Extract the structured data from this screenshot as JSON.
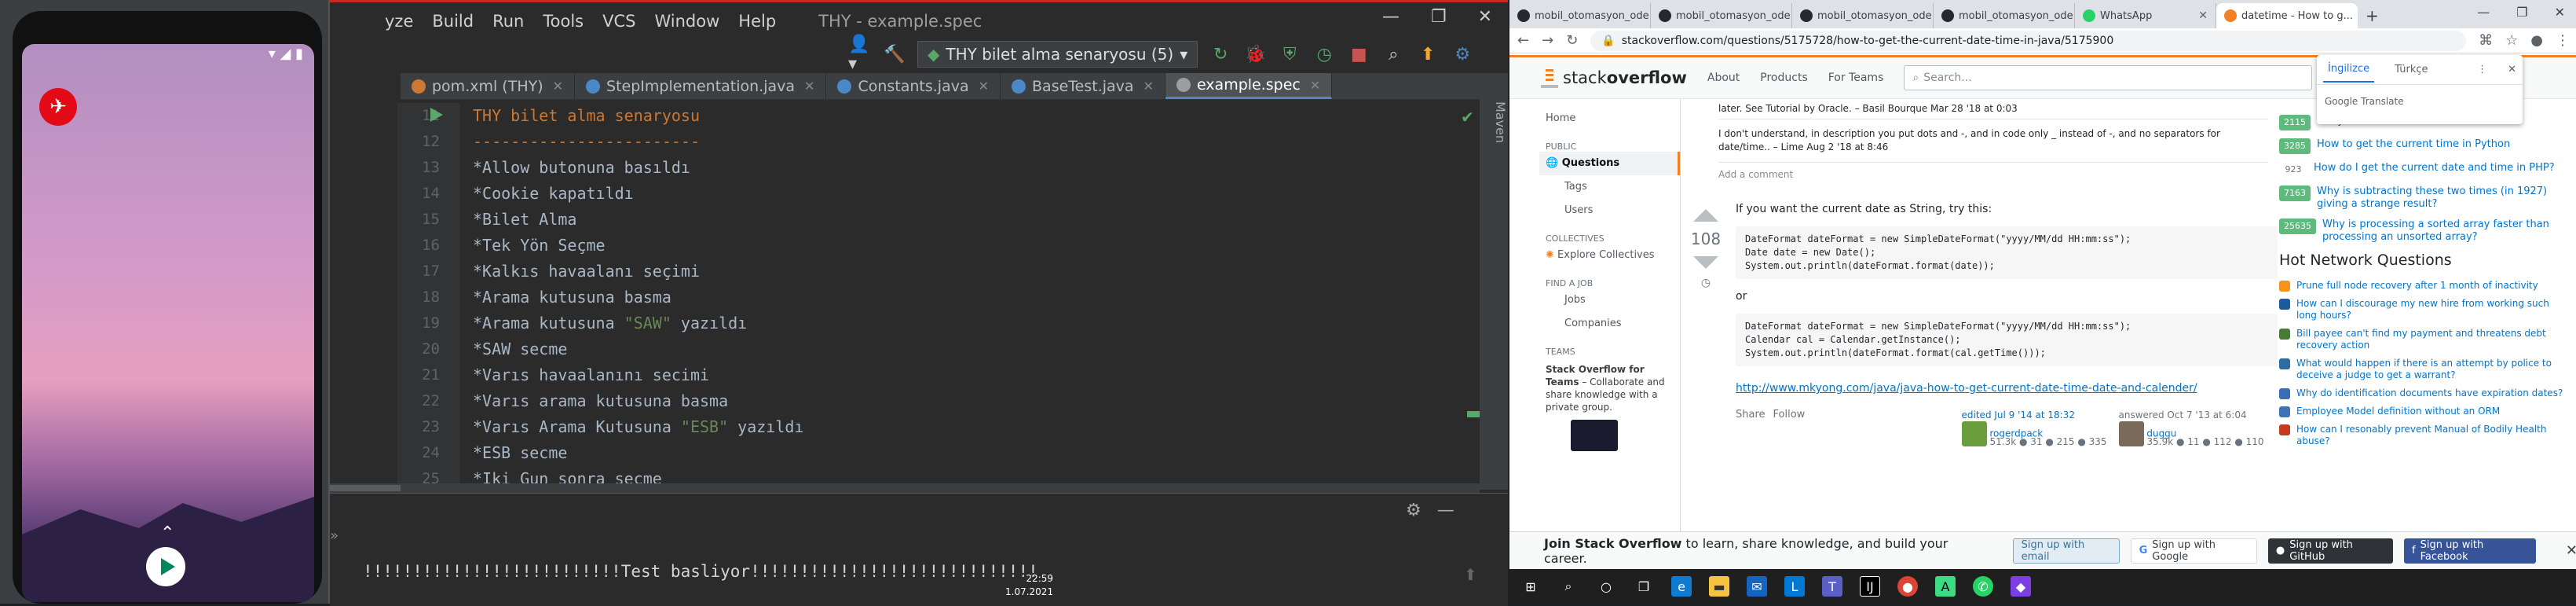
{
  "emulator": {
    "status_time": "",
    "logo_letter": "✈"
  },
  "ide": {
    "menu": [
      "yze",
      "Build",
      "Run",
      "Tools",
      "VCS",
      "Window",
      "Help"
    ],
    "title": "THY - example.spec",
    "run_config": "THY bilet alma senaryosu (5)",
    "tabs": [
      {
        "label": "pom.xml (THY)",
        "icon_color": "#cc7832",
        "active": false
      },
      {
        "label": "StepImplementation.java",
        "icon_color": "#4a88c7",
        "active": false
      },
      {
        "label": "Constants.java",
        "icon_color": "#4a88c7",
        "active": false
      },
      {
        "label": "BaseTest.java",
        "icon_color": "#4a88c7",
        "active": false
      },
      {
        "label": "example.spec",
        "icon_color": "#9e9e9e",
        "active": true
      }
    ],
    "right_strip_label": "Maven",
    "line_numbers": [
      "11",
      "12",
      "13",
      "14",
      "15",
      "16",
      "17",
      "18",
      "19",
      "20",
      "21",
      "22",
      "23",
      "24",
      "25"
    ],
    "code_lines": [
      {
        "pre": "THY bilet alma senaryosu",
        "str": "",
        "post": "",
        "kind": "heading"
      },
      {
        "pre": "------------------------",
        "str": "",
        "post": "",
        "kind": "heading"
      },
      {
        "pre": "*Allow butonuna basıldı",
        "str": "",
        "post": "",
        "kind": "text"
      },
      {
        "pre": "*Cookie kapatıldı",
        "str": "",
        "post": "",
        "kind": "text"
      },
      {
        "pre": "*Bilet Alma",
        "str": "",
        "post": "",
        "kind": "text"
      },
      {
        "pre": "*Tek Yön Seçme",
        "str": "",
        "post": "",
        "kind": "text"
      },
      {
        "pre": "*Kalkıs havaalanı seçimi",
        "str": "",
        "post": "",
        "kind": "text"
      },
      {
        "pre": "*Arama kutusuna basma",
        "str": "",
        "post": "",
        "kind": "text"
      },
      {
        "pre": "*Arama kutusuna ",
        "str": "\"SAW\"",
        "post": " yazıldı",
        "kind": "text"
      },
      {
        "pre": "*SAW secme",
        "str": "",
        "post": "",
        "kind": "text"
      },
      {
        "pre": "*Varıs havaalanını secimi",
        "str": "",
        "post": "",
        "kind": "text"
      },
      {
        "pre": "*Varıs arama kutusuna basma",
        "str": "",
        "post": "",
        "kind": "text"
      },
      {
        "pre": "*Varıs Arama Kutusuna ",
        "str": "\"ESB\"",
        "post": " yazıldı",
        "kind": "text"
      },
      {
        "pre": "*ESB secme",
        "str": "",
        "post": "",
        "kind": "text"
      },
      {
        "pre": "*Iki Gun sonra secme",
        "str": "",
        "post": "",
        "kind": "text"
      }
    ],
    "console_text": "!!!!!!!!!!!!!!!!!!!!!!!!!!Test basliyor!!!!!!!!!!!!!!!!!!!!!!!!!!!!!"
  },
  "browser": {
    "tabs": [
      {
        "label": "mobil_otomasyon_ode",
        "active": false
      },
      {
        "label": "mobil_otomasyon_ode",
        "active": false
      },
      {
        "label": "mobil_otomasyon_ode",
        "active": false
      },
      {
        "label": "mobil_otomasyon_ode",
        "active": false
      },
      {
        "label": "WhatsApp",
        "active": false
      },
      {
        "label": "datetime - How to g...",
        "active": true
      }
    ],
    "url": "stackoverflow.com/questions/5175728/how-to-get-the-current-date-time-in-java/5175900",
    "translate": {
      "lang1": "İngilizce",
      "lang2": "Türkçe",
      "footer": "Google Translate"
    }
  },
  "so": {
    "logo_a": "stack",
    "logo_b": "overflow",
    "nav": [
      "About",
      "Products",
      "For Teams"
    ],
    "search_placeholder": "Search...",
    "left": {
      "home": "Home",
      "public": "PUBLIC",
      "questions": "Questions",
      "tags": "Tags",
      "users": "Users",
      "collectives": "COLLECTIVES",
      "explore": "Explore Collectives",
      "find_job": "FIND A JOB",
      "jobs": "Jobs",
      "companies": "Companies",
      "teams": "TEAMS",
      "teams_title": "Stack Overflow for Teams",
      "teams_text": " – Collaborate and share knowledge with a private group."
    },
    "comment1": "later. See Tutorial by Oracle. – Basil Bourque Mar 28 '18 at 0:03",
    "comment2": "I don't understand, in description you put dots and -, and in code only _ instead of -, and no separators for date/time.. – Lime Aug 2 '18 at 8:46",
    "add_comment": "Add a comment",
    "answer_intro": "If you want the current date as String, try this:",
    "vote_count": "108",
    "code1": [
      "DateFormat dateFormat = new SimpleDateFormat(\"yyyy/MM/dd HH:mm:ss\");",
      "Date date = new Date();",
      "System.out.println(dateFormat.format(date));"
    ],
    "or": "or",
    "code2": [
      "DateFormat dateFormat = new SimpleDateFormat(\"yyyy/MM/dd HH:mm:ss\");",
      "Calendar cal = Calendar.getInstance();",
      "System.out.println(dateFormat.format(cal.getTime()));"
    ],
    "link": "http://www.mkyong.com/java/java-how-to-get-current-date-time-date-and-calender/",
    "share": "Share",
    "follow": "Follow",
    "edited": "edited Jul 9 '14 at 18:32",
    "editor": "rogerdpack",
    "editor_rep": "51.3k ● 31 ● 215 ● 335",
    "answered": "answered Oct 7 '13 at 6:04",
    "answerer": "duggu",
    "answerer_rep": "35.9k ● 11 ● 112 ● 110",
    "related": [
      {
        "count": "2115",
        "text": "array?",
        "green": true
      },
      {
        "count": "3285",
        "text": "How to get the current time in Python",
        "green": true
      },
      {
        "count": "923",
        "text": "How do I get the current date and time in PHP?",
        "green": false
      },
      {
        "count": "7163",
        "text": "Why is subtracting these two times (in 1927) giving a strange result?",
        "green": true
      },
      {
        "count": "25635",
        "text": "Why is processing a sorted array faster than processing an unsorted array?",
        "green": true
      }
    ],
    "hot_title": "Hot Network Questions",
    "hot": [
      {
        "text": "Prune full node recovery after 1 month of inactivity",
        "color": "#f7931a"
      },
      {
        "text": "How can I discourage my new hire from working such long hours?",
        "color": "#1e5a9c"
      },
      {
        "text": "Bill payee can't find my payment and threatens debt recovery action",
        "color": "#4a7a3a"
      },
      {
        "text": "What would happen if there is an attempt by police to deceive a judge to get a warrant?",
        "color": "#2d6ca2"
      },
      {
        "text": "Why do identification documents have expiration dates?",
        "color": "#3b6cb4"
      },
      {
        "text": "Employee Model definition without an ORM",
        "color": "#4072b4"
      },
      {
        "text": "How can I resonably prevent Manual of Bodily Health abuse?",
        "color": "#c23b22"
      }
    ],
    "banner_bold": "Join Stack Overflow",
    "banner_text": " to learn, share knowledge, and build your career.",
    "btn_email": "Sign up with email",
    "btn_google": "Sign up with Google",
    "btn_github": "Sign up with GitHub",
    "btn_facebook": "Sign up with Facebook"
  },
  "taskbar": {
    "time": "22:59",
    "date": "1.07.2021"
  }
}
